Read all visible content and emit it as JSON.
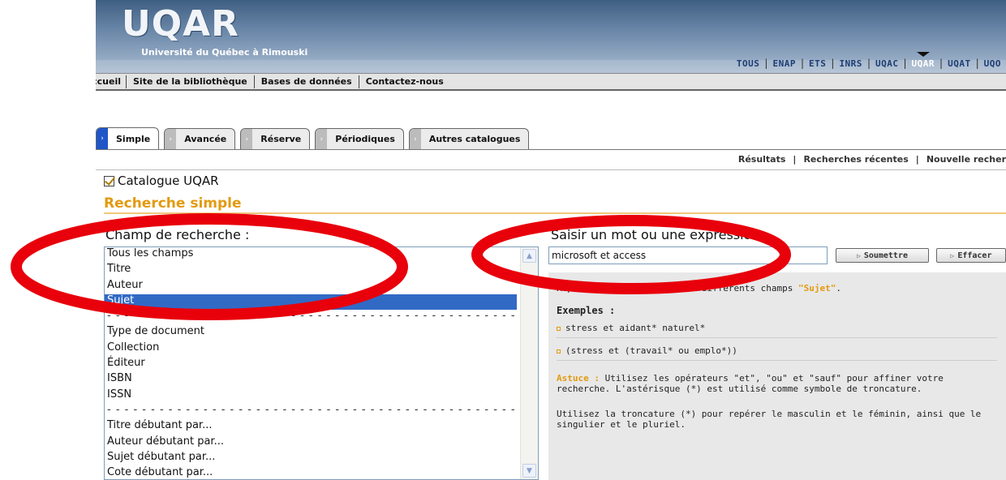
{
  "header": {
    "logo": "UQAR",
    "subtitle": "Université du Québec à Rimouski",
    "network": [
      {
        "label": "TOUS",
        "active": false
      },
      {
        "label": "ENAP",
        "active": false
      },
      {
        "label": "ETS",
        "active": false
      },
      {
        "label": "INRS",
        "active": false
      },
      {
        "label": "UQAC",
        "active": false
      },
      {
        "label": "UQAR",
        "active": true
      },
      {
        "label": "UQAT",
        "active": false
      },
      {
        "label": "UQO",
        "active": false
      }
    ]
  },
  "nav": {
    "items": [
      "ccueil",
      "Site de la bibliothèque",
      "Bases de données",
      "Contactez-nous"
    ]
  },
  "tabs": [
    "Simple",
    "Avancée",
    "Réserve",
    "Périodiques",
    "Autres catalogues"
  ],
  "sublinks": [
    "Résultats",
    "Recherches récentes",
    "Nouvelle recher"
  ],
  "catalogue_title": "Catalogue UQAR",
  "section_heading": "Recherche simple",
  "field": {
    "label": "Champ de recherche :",
    "options": [
      "Tous les champs",
      "Titre",
      "Auteur",
      "Sujet",
      "- - - - - - - - - - - - - - - - - - - - - - - - - - - - - - - - - - - - - - - - - - - - - - -",
      "Type de document",
      "Collection",
      "Éditeur",
      "ISBN",
      "ISSN",
      "- - - - - - - - - - - - - - - - - - - - - - - - - - - - - - - - - - - - - - - - - - - - - - -",
      "Titre débutant par...",
      "Auteur débutant par...",
      "Sujet débutant par...",
      "Cote débutant par..."
    ],
    "selected": "Sujet"
  },
  "search": {
    "label": "Saisir un mot ou une expression :",
    "value": "microsoft et access",
    "submit": "Soumettre",
    "clear": "Effacer"
  },
  "help": {
    "hint_prefix": "Repère un(des) mot(s) dans différents champs ",
    "hint_field": "\"Sujet\"",
    "hint_suffix": ".",
    "examples_title": "Exemples :",
    "examples": [
      "stress et aidant* naturel*",
      "(stress et (travail* ou emplo*))"
    ],
    "astuce_label": "Astuce :",
    "astuce_text": "Utilisez les opérateurs \"et\", \"ou\" et \"sauf\" pour affiner votre recherche. L'astérisque (*) est utilisé comme symbole de troncature.",
    "truncation_text": "Utilisez la troncature (*) pour repérer le masculin et le féminin, ainsi que le singulier et le pluriel."
  },
  "colors": {
    "accent_orange": "#e39a10",
    "selection_blue": "#316ac5",
    "annotation_red": "#e8000b"
  }
}
